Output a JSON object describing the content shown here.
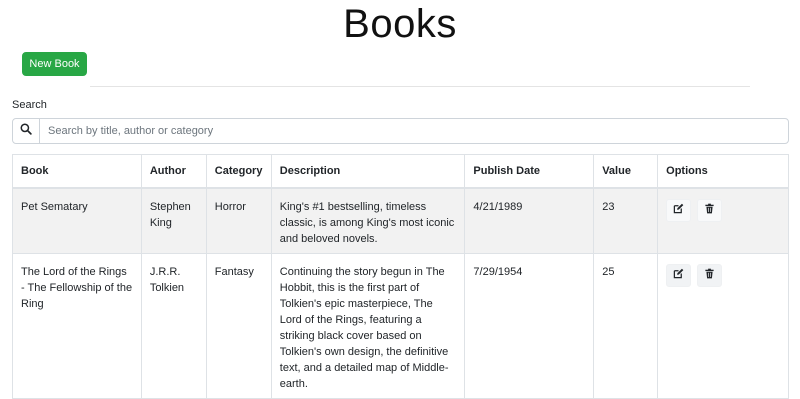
{
  "page": {
    "title": "Books"
  },
  "toolbar": {
    "new_book_label": "New Book"
  },
  "search": {
    "label": "Search",
    "placeholder": "Search by title, author or category",
    "value": ""
  },
  "table": {
    "headers": {
      "book": "Book",
      "author": "Author",
      "category": "Category",
      "description": "Description",
      "publish_date": "Publish Date",
      "value": "Value",
      "options": "Options"
    },
    "rows": [
      {
        "book": "Pet Sematary",
        "author": "Stephen King",
        "category": "Horror",
        "description": "King's #1 bestselling, timeless classic, is among King's most iconic and beloved novels.",
        "publish_date": "4/21/1989",
        "value": "23"
      },
      {
        "book": "The Lord of the Rings - The Fellowship of the Ring",
        "author": "J.R.R. Tolkien",
        "category": "Fantasy",
        "description": "Continuing the story begun in The Hobbit, this is the first part of Tolkien's epic masterpiece, The Lord of the Rings, featuring a striking black cover based on Tolkien's own design, the definitive text, and a detailed map of Middle-earth.",
        "publish_date": "7/29/1954",
        "value": "25"
      }
    ]
  },
  "icons": {
    "search": "search-icon",
    "edit": "edit-icon",
    "delete": "trash-icon"
  },
  "colors": {
    "primary_button": "#28a745",
    "striped_row": "#f2f2f2",
    "border": "#dee2e6"
  }
}
